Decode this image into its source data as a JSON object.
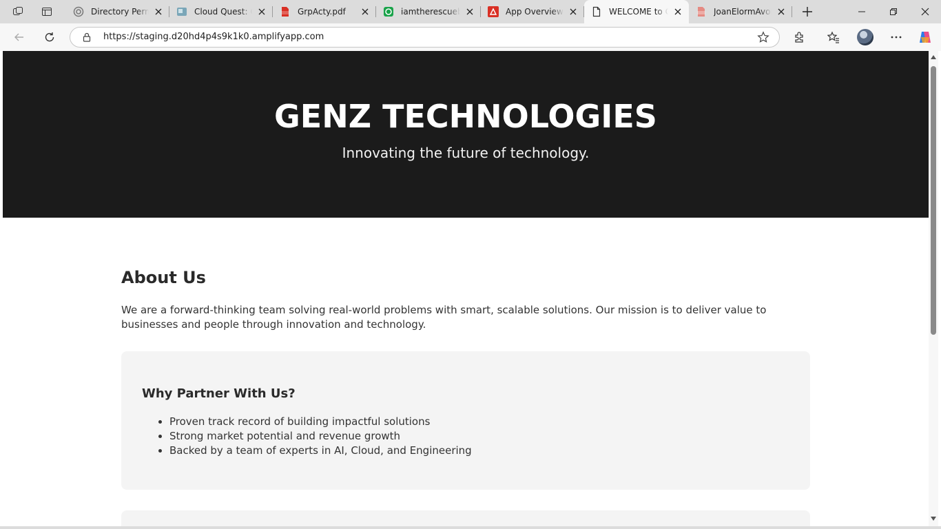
{
  "browser": {
    "tabs": [
      {
        "title": "Directory Permissions",
        "favicon": "gear-icon"
      },
      {
        "title": "Cloud Quest: Open",
        "favicon": "cloud-quest-icon"
      },
      {
        "title": "GrpActy.pdf",
        "favicon": "pdf-icon"
      },
      {
        "title": "iamtherescuebuddy",
        "favicon": "whatsapp-icon"
      },
      {
        "title": "App Overview | Amplify",
        "favicon": "amplify-icon"
      },
      {
        "title": "WELCOME to GENZ",
        "favicon": "page-icon",
        "active": true
      },
      {
        "title": "JoanElormAvornyo",
        "favicon": "pdf-icon"
      }
    ],
    "address_bar": {
      "url": "https://staging.d20hd4p4s9k1k0.amplifyapp.com"
    }
  },
  "page": {
    "hero": {
      "title": "GENZ TECHNOLOGIES",
      "tagline": "Innovating the future of technology."
    },
    "about": {
      "heading": "About Us",
      "text": "We are a forward-thinking team solving real-world problems with smart, scalable solutions. Our mission is to deliver value to businesses and people through innovation and technology."
    },
    "partner": {
      "heading": "Why Partner With Us?",
      "items": [
        "Proven track record of building impactful solutions",
        "Strong market potential and revenue growth",
        "Backed by a team of experts in AI, Cloud, and Engineering"
      ]
    }
  },
  "colors": {
    "hero_bg": "#1b1b1b",
    "card_bg": "#f4f4f4",
    "tabstrip_bg": "#dcdcdc"
  }
}
